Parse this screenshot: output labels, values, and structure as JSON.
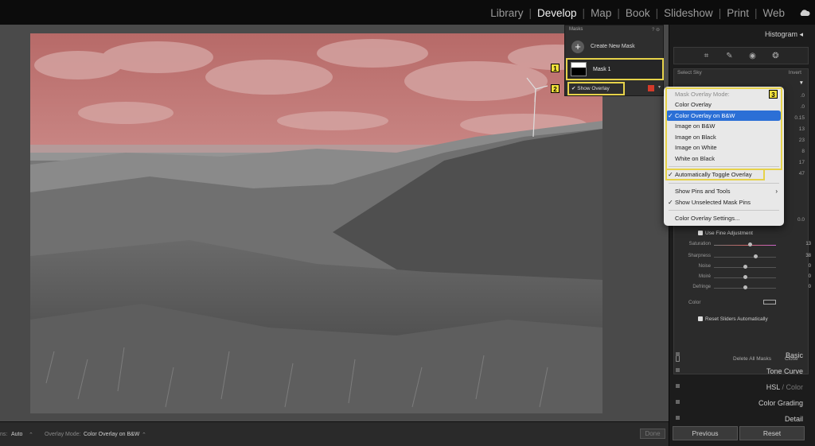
{
  "top_nav": {
    "modules": [
      "Library",
      "Develop",
      "Map",
      "Book",
      "Slideshow",
      "Print",
      "Web"
    ],
    "active": "Develop"
  },
  "masks_panel": {
    "title": "Masks",
    "create_label": "Create New Mask",
    "mask_name": "Mask 1",
    "show_overlay_label": "Show Overlay",
    "overlay_color": "#d23a2a"
  },
  "overlay_menu": {
    "header": "Mask Overlay Mode:",
    "modes": [
      {
        "label": "Color Overlay",
        "checked": false
      },
      {
        "label": "Color Overlay on B&W",
        "checked": true
      },
      {
        "label": "Image on B&W",
        "checked": false
      },
      {
        "label": "Image on Black",
        "checked": false
      },
      {
        "label": "Image on White",
        "checked": false
      },
      {
        "label": "White on Black",
        "checked": false
      }
    ],
    "auto_toggle": "Automatically Toggle Overlay",
    "show_pins": "Show Pins and Tools",
    "show_unselected": "Show Unselected Mask Pins",
    "settings": "Color Overlay Settings..."
  },
  "badges": [
    "1",
    "2",
    "3"
  ],
  "right_panel": {
    "histogram": "Histogram",
    "select_sky": "Select Sky",
    "invert": "Invert",
    "use_fine": "Use Fine Adjustment",
    "sliders": [
      {
        "label": "Saturation",
        "value": "13",
        "pos": 0.56
      },
      {
        "label": "Sharpness",
        "value": "38",
        "pos": 0.64
      },
      {
        "label": "Noise",
        "value": "0",
        "pos": 0.5
      },
      {
        "label": "Moiré",
        "value": "0",
        "pos": 0.5
      },
      {
        "label": "Defringe",
        "value": "0",
        "pos": 0.5
      }
    ],
    "color_label": "Color",
    "reset_sliders": "Reset Sliders Automatically",
    "delete_all": "Delete All Masks",
    "close": "Close",
    "sections": [
      "Basic",
      "Tone Curve",
      "HSL / Color",
      "Color Grading",
      "Detail"
    ],
    "hsl_parts": [
      "HSL",
      "Color"
    ],
    "previous": "Previous",
    "reset": "Reset",
    "partial_values": [
      ".0",
      ".0",
      "0.15",
      "13",
      "23",
      "8",
      "17",
      "47",
      "0.0"
    ]
  },
  "bottom_bar": {
    "auto_label": "ns:",
    "auto_value": "Auto",
    "overlay_mode_label": "Overlay Mode:",
    "overlay_mode_value": "Color Overlay on B&W",
    "done": "Done"
  }
}
